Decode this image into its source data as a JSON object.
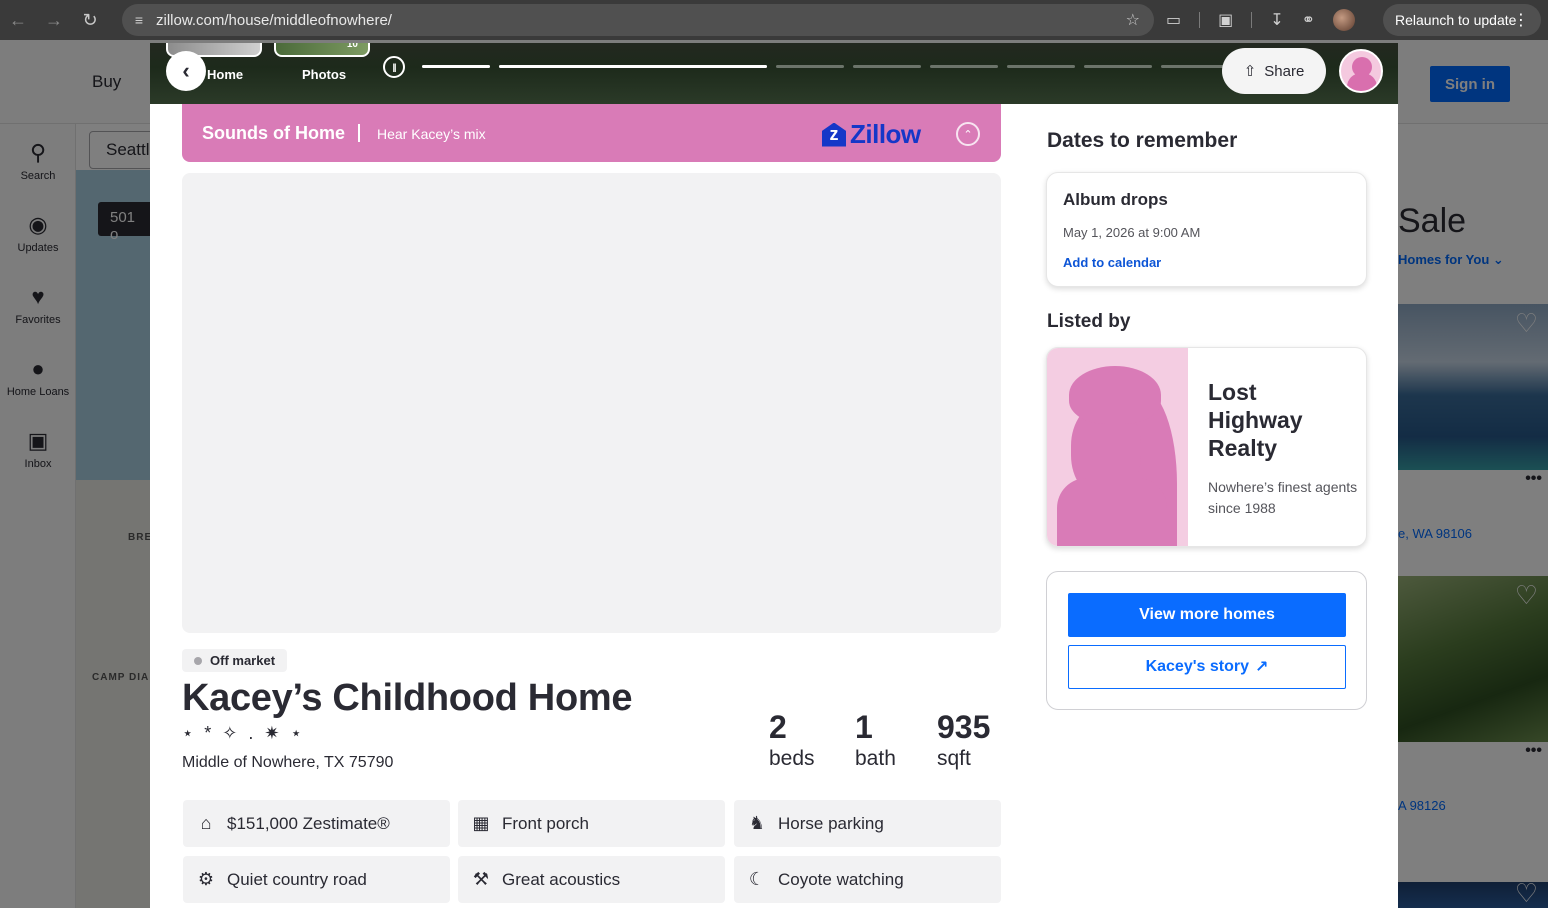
{
  "browser": {
    "url": "zillow.com/house/middleofnowhere/",
    "relaunch_label": "Relaunch to update",
    "icons": [
      "back-arrow-icon",
      "forward-arrow-icon",
      "reload-icon",
      "site-settings-icon",
      "bookmark-star-icon",
      "extensions-icon",
      "lens-icon",
      "download-icon",
      "performance-icon",
      "more-vertical-icon"
    ]
  },
  "background": {
    "nav_buy": "Buy",
    "sign_in": "Sign in",
    "search_value": "Seattl",
    "map_chip": "501 o",
    "map_labels": [
      "BRE",
      "CAMP DIA"
    ],
    "sidebar": [
      {
        "label": "Search",
        "icon": "search-icon"
      },
      {
        "label": "Updates",
        "icon": "updates-icon"
      },
      {
        "label": "Favorites",
        "icon": "heart-icon"
      },
      {
        "label": "Home Loans",
        "icon": "dollar-icon"
      },
      {
        "label": "Inbox",
        "icon": "inbox-icon"
      }
    ],
    "right_heading": "Sale",
    "homes_for_you": "Homes for You",
    "listing_addresses": [
      "e, WA 98106",
      "A 98126"
    ]
  },
  "modal": {
    "tabs": [
      {
        "label": "Home"
      },
      {
        "label": "Photos",
        "photo_count": "10"
      }
    ],
    "story_progress": [
      1,
      1,
      0,
      0,
      0,
      0,
      0,
      0
    ],
    "share_label": "Share",
    "banner": {
      "title": "Sounds of Home",
      "subtitle": "Hear Kacey’s mix",
      "logo_text": "Zillow",
      "color": "#d97bb7"
    },
    "status_badge": "Off market",
    "property": {
      "title": "Kacey’s Childhood Home",
      "sparkles": "⋆ * ✧ . ✷ ⋆",
      "address": "Middle of Nowhere, TX 75790"
    },
    "stats": [
      {
        "value": "2",
        "label": "beds"
      },
      {
        "value": "1",
        "label": "bath"
      },
      {
        "value": "935",
        "label": "sqft"
      }
    ],
    "features": [
      {
        "label": "$151,000 Zestimate®",
        "icon": "zillow-house-icon"
      },
      {
        "label": "Front porch",
        "icon": "building-icon"
      },
      {
        "label": "Horse parking",
        "icon": "horse-icon"
      },
      {
        "label": "Quiet country road",
        "icon": "tractor-icon"
      },
      {
        "label": "Great acoustics",
        "icon": "hammer-icon"
      },
      {
        "label": "Coyote watching",
        "icon": "moon-icon"
      }
    ],
    "dates": {
      "heading": "Dates to remember",
      "album_title": "Album drops",
      "album_date": "May 1, 2026 at 9:00 AM",
      "add_to_calendar": "Add to calendar"
    },
    "listed_by": {
      "heading": "Listed by",
      "agency": "Lost Highway Realty",
      "tagline": "Nowhere’s finest agents since 1988"
    },
    "actions": {
      "view_more": "View more homes",
      "story": "Kacey's story"
    },
    "colors": {
      "accent_blue": "#0a6cff",
      "zillow_blue": "#1537c8",
      "pink": "#d97bb7"
    }
  }
}
